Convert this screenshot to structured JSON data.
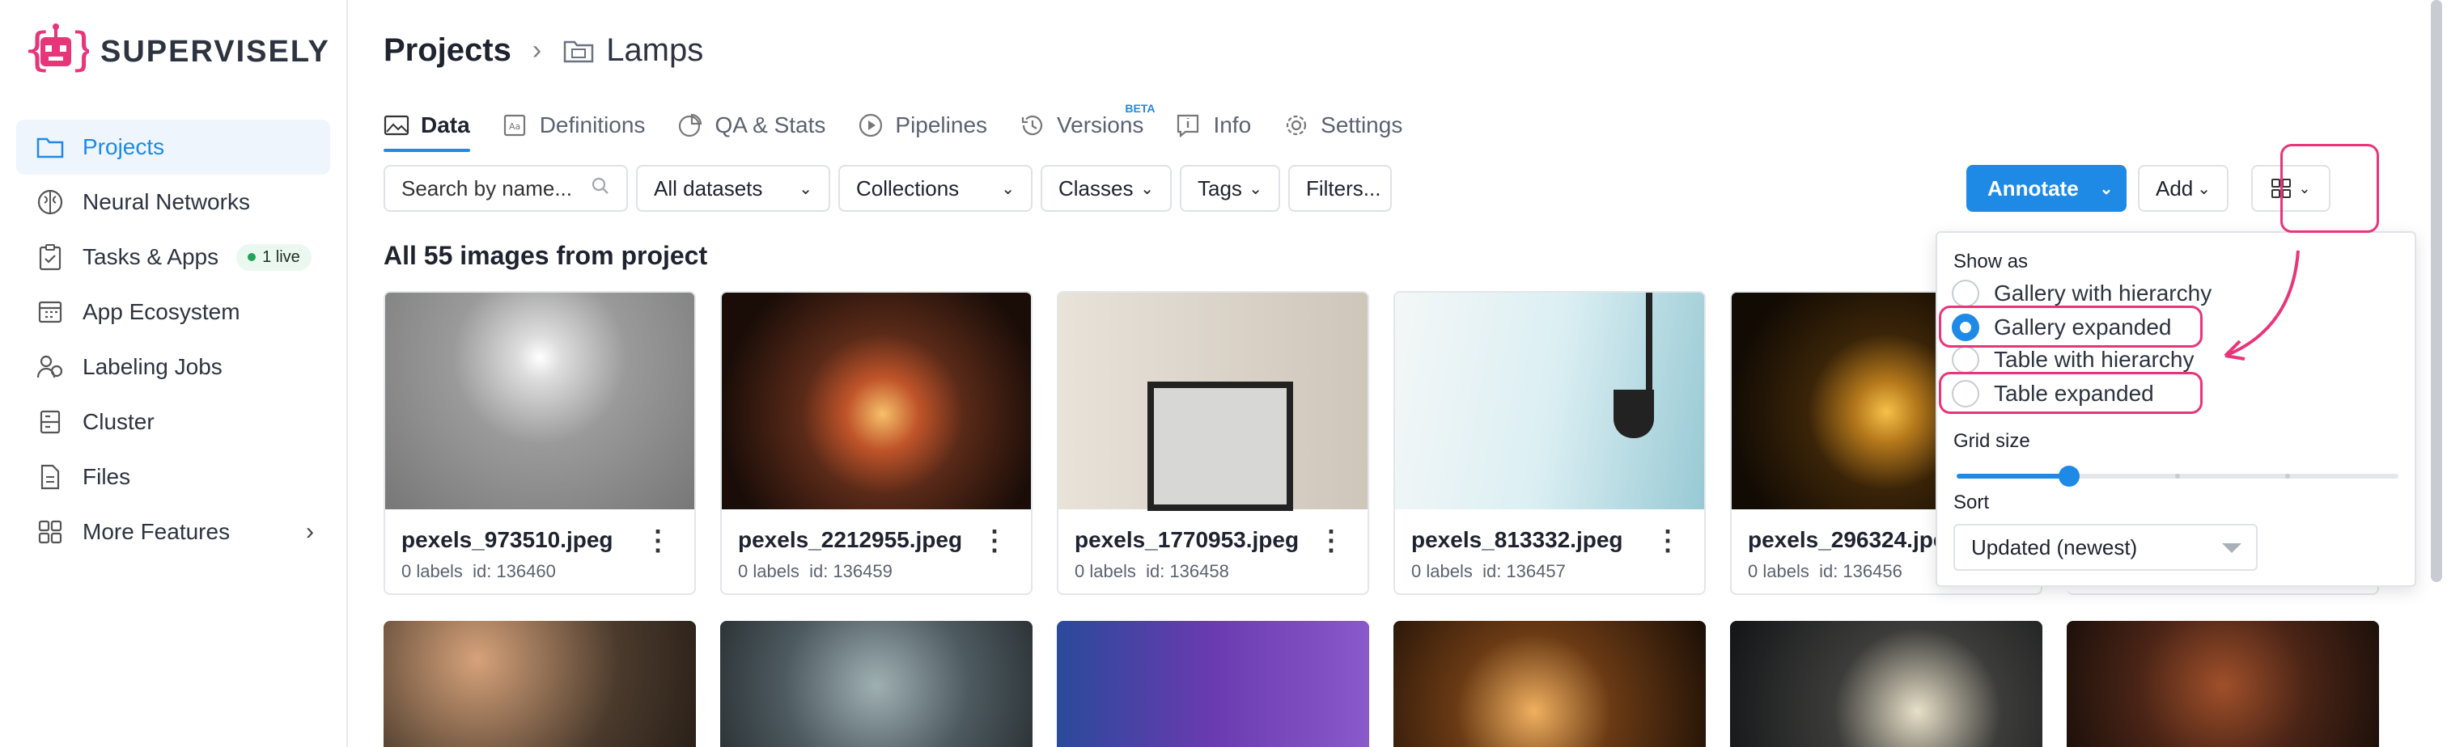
{
  "brand": {
    "name": "SUPERVISELY",
    "accent": "#1e8ae6",
    "highlight": "#e8357a"
  },
  "sidebar": {
    "items": [
      {
        "label": "Projects",
        "icon": "folder-icon",
        "active": true
      },
      {
        "label": "Neural Networks",
        "icon": "brain-icon"
      },
      {
        "label": "Tasks & Apps",
        "icon": "clipboard-icon",
        "badge": "1 live"
      },
      {
        "label": "App Ecosystem",
        "icon": "grid-calendar-icon"
      },
      {
        "label": "Labeling Jobs",
        "icon": "users-icon"
      },
      {
        "label": "Cluster",
        "icon": "server-icon"
      },
      {
        "label": "Files",
        "icon": "file-icon"
      },
      {
        "label": "More Features",
        "icon": "apps-icon"
      }
    ]
  },
  "breadcrumb": {
    "root": "Projects",
    "current": "Lamps"
  },
  "tabs": [
    {
      "label": "Data",
      "active": true
    },
    {
      "label": "Definitions"
    },
    {
      "label": "QA & Stats"
    },
    {
      "label": "Pipelines"
    },
    {
      "label": "Versions",
      "badge": "BETA"
    },
    {
      "label": "Info"
    },
    {
      "label": "Settings"
    }
  ],
  "toolbar": {
    "search_placeholder": "Search by name...",
    "datasets": "All datasets",
    "collections": "Collections",
    "classes": "Classes",
    "tags": "Tags",
    "filters": "Filters...",
    "annotate": "Annotate",
    "add": "Add"
  },
  "heading": "All 55 images from project",
  "images": [
    {
      "name": "pexels_973510.jpeg",
      "labels": "0 labels",
      "id": "id: 136460",
      "color": "#8f8f8f"
    },
    {
      "name": "pexels_2212955.jpeg",
      "labels": "0 labels",
      "id": "id: 136459",
      "color": "#3a1f14"
    },
    {
      "name": "pexels_1770953.jpeg",
      "labels": "0 labels",
      "id": "id: 136458",
      "color": "#d8cfc4"
    },
    {
      "name": "pexels_813332.jpeg",
      "labels": "0 labels",
      "id": "id: 136457",
      "color": "#cfe4ea"
    },
    {
      "name": "pexels_296324.jpeg",
      "labels": "0 labels",
      "id": "id: 136456",
      "color": "#1e140a"
    }
  ],
  "second_row_colors": [
    "#4a3a2c",
    "#4d5a60",
    "#3b2a5a",
    "#2a1c12",
    "#1c2228",
    "#2e1c14"
  ],
  "view_menu": {
    "show_as_label": "Show as",
    "options": [
      {
        "label": "Gallery with hierarchy",
        "selected": false
      },
      {
        "label": "Gallery expanded",
        "selected": true
      },
      {
        "label": "Table with hierarchy",
        "selected": false
      },
      {
        "label": "Table expanded",
        "selected": false
      }
    ],
    "grid_size_label": "Grid size",
    "grid_size": 0.25,
    "sort_label": "Sort",
    "sort_value": "Updated (newest)"
  }
}
